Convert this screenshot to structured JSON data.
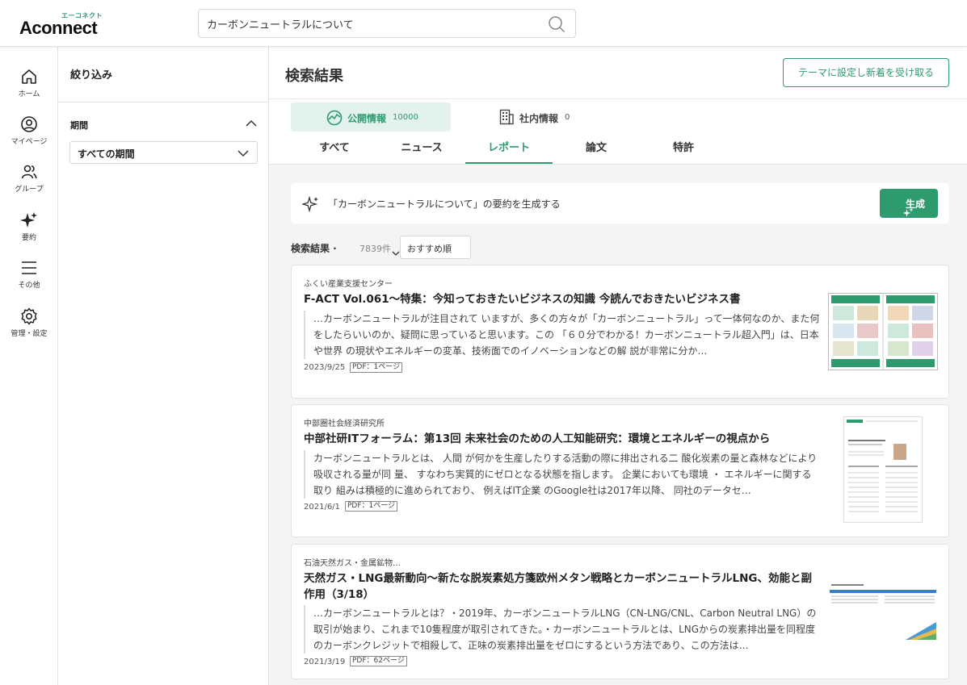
{
  "header": {
    "logo_sub": "エーコネクト",
    "logo_main": "Aconnect",
    "search_value": "カーボンニュートラルについて"
  },
  "nav": [
    {
      "label": "ホーム",
      "icon": "home-icon"
    },
    {
      "label": "マイページ",
      "icon": "user-icon"
    },
    {
      "label": "グループ",
      "icon": "group-icon"
    },
    {
      "label": "要約",
      "icon": "sparkle-icon"
    },
    {
      "label": "その他",
      "icon": "menu-icon"
    },
    {
      "label": "管理・設定",
      "icon": "gear-icon"
    }
  ],
  "filter": {
    "title": "絞り込み",
    "period_label": "期間",
    "period_value": "すべての期間"
  },
  "main": {
    "title": "検索結果",
    "theme_button": "テーマに設定し新着を受け取る",
    "source_tabs": [
      {
        "label": "公開情報",
        "count": "10000"
      },
      {
        "label": "社内情報",
        "count": "0"
      }
    ],
    "category_tabs": [
      "すべて",
      "ニュース",
      "レポート",
      "論文",
      "特許"
    ],
    "active_category": "レポート",
    "summary_text": "「カーボンニュートラルについて」の要約を生成する",
    "generate_button": "生成",
    "results_label": "検索結果 ·",
    "results_count": "7839件",
    "sort_value": "おすすめ順"
  },
  "results": [
    {
      "source": "ふくい産業支援センター",
      "title": "F-ACT Vol.061〜特集：今知っておきたいビジネスの知識 今読んでおきたいビジネス書",
      "snippet": "…カーボンニュートラルが注目されて いますが、多くの方々が「カーボンニュートラル」って一体何なのか、また何をしたらいいのか、疑問に思っていると思います。この 「６０分でわかる！カーボンニュートラル超入門」は、日本や世界 の現状やエネルギーの変革、技術面でのイノベーションなどの解 説が非常に分か…",
      "date": "2023/9/25",
      "badge": "PDF：1ページ"
    },
    {
      "source": "中部圏社会経済研究所",
      "title": "中部社研ITフォーラム：第13回 未来社会のための人工知能研究：環境とエネルギーの視点から",
      "snippet": "カーボンニュートラルとは、 人間 が何かを生産したりする活動の際に排出される二 酸化炭素の量と森林などにより吸収される量が同 量、 すなわち実質的にゼロとなる状態を指します。 企業においても環境 ・ エネルギーに関する取り 組みは積極的に進められており、 例えばIT企業 のGoogle社は2017年以降、 同社のデータセ…",
      "date": "2021/6/1",
      "badge": "PDF：1ページ"
    },
    {
      "source": "石油天然ガス・金属鉱物…",
      "title": "天然ガス・LNG最新動向〜新たな脱炭素処方箋欧州メタン戦略とカーボンニュートラルLNG、効能と副作用（3/18）",
      "snippet": "…カーボンニュートラルとは？・2019年、カーボンニュートラルLNG（CN-LNG/CNL、Carbon Neutral LNG）の取引が始まり、これまで10隻程度が取引されてきた。・カーボンニュートラルとは、LNGからの炭素排出量を同程度のカーボンクレジットで相殺して、正味の炭素排出量をゼロにするという方法であり、この方法は…",
      "date": "2021/3/19",
      "badge": "PDF：62ページ"
    }
  ],
  "colors": {
    "accent": "#2e9b6e",
    "accent_light": "#e3f2ec"
  }
}
